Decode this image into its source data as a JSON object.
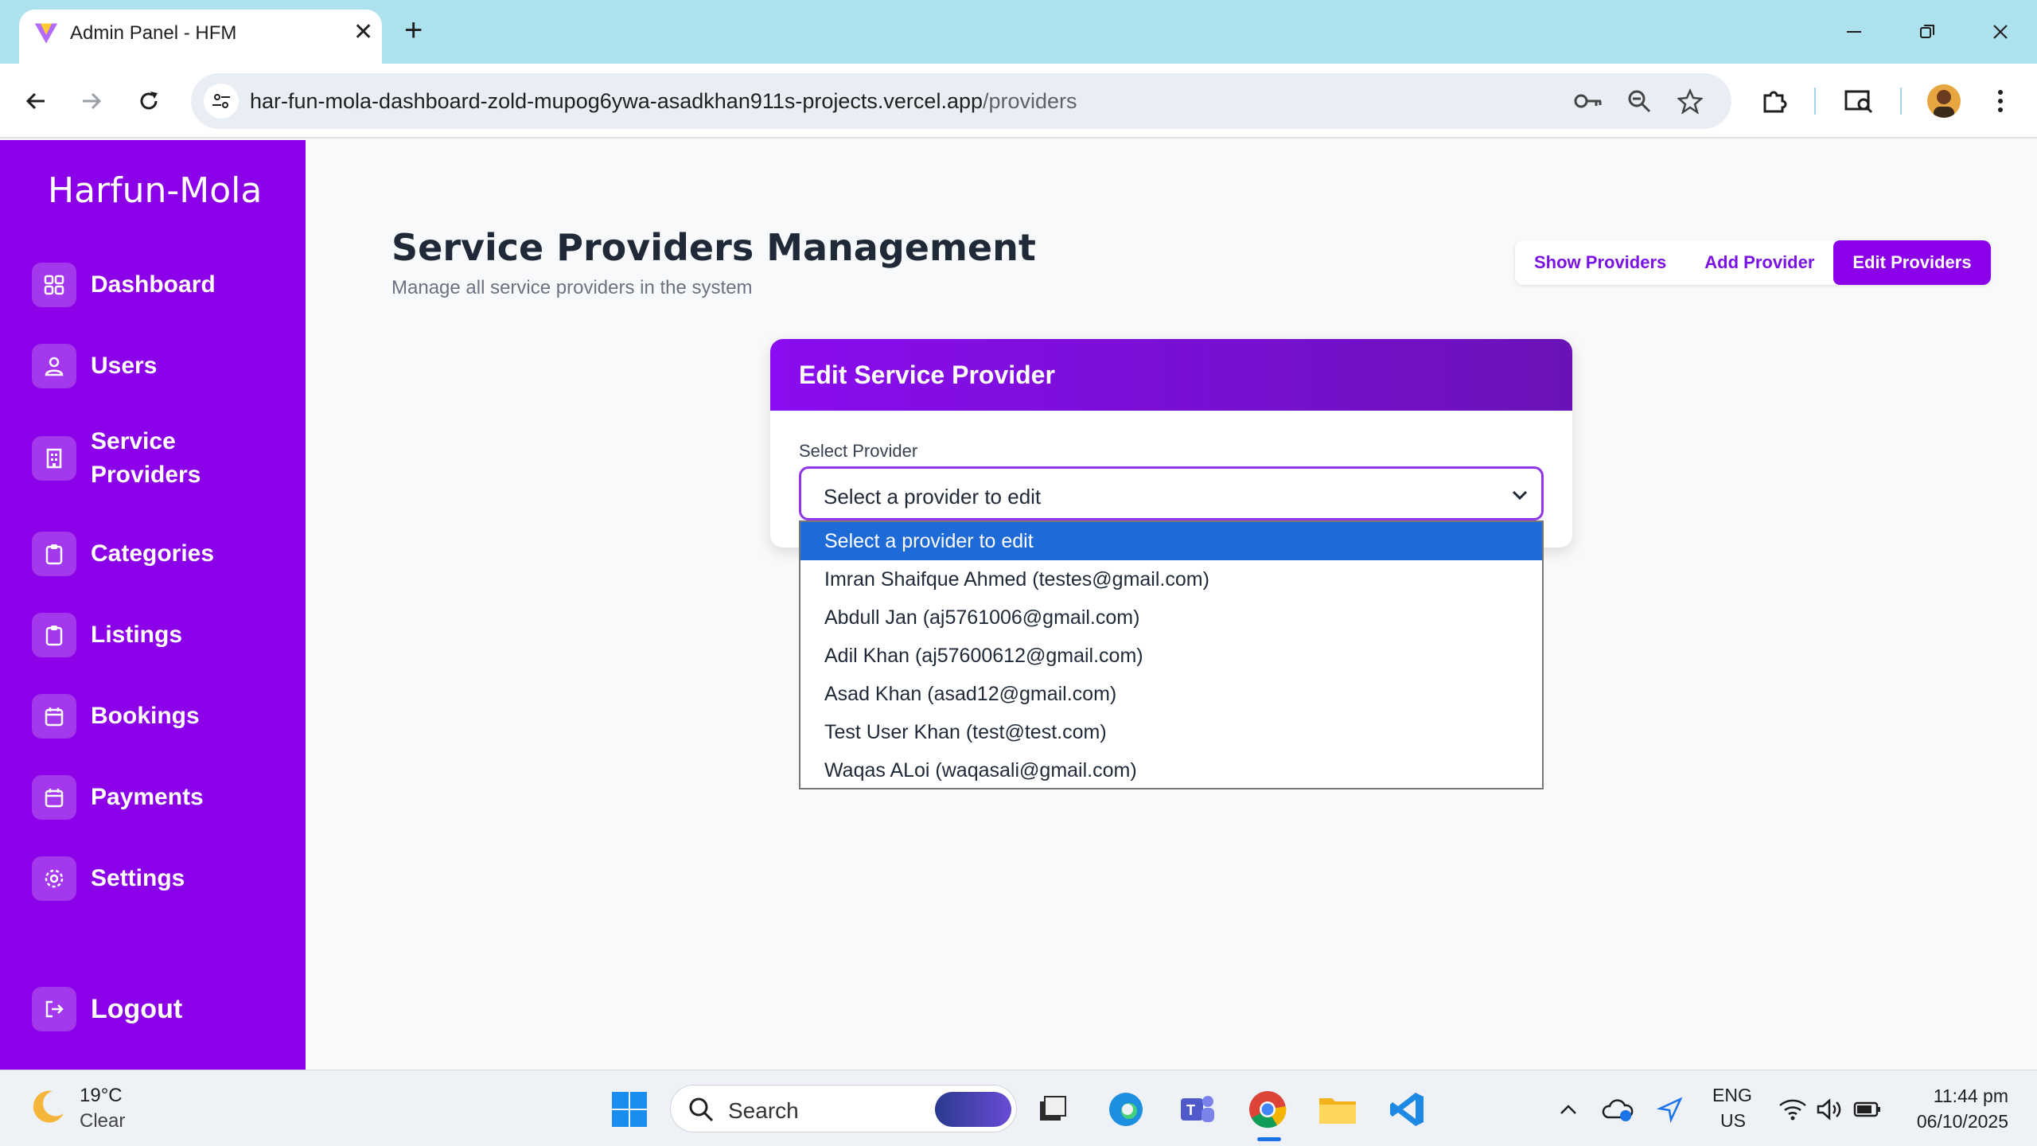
{
  "browser": {
    "tab_title": "Admin Panel - HFM",
    "url_host": "har-fun-mola-dashboard-zold-mupog6ywa-asadkhan911s-projects.vercel.app",
    "url_path": "/providers"
  },
  "sidebar": {
    "brand": "Harfun-Mola",
    "items": [
      {
        "label": "Dashboard",
        "icon": "grid-icon"
      },
      {
        "label": "Users",
        "icon": "users-icon"
      },
      {
        "label": "Service Providers",
        "icon": "building-icon"
      },
      {
        "label": "Categories",
        "icon": "clipboard-icon"
      },
      {
        "label": "Listings",
        "icon": "clipboard-icon"
      },
      {
        "label": "Bookings",
        "icon": "calendar-icon"
      },
      {
        "label": "Payments",
        "icon": "calendar-icon"
      },
      {
        "label": "Settings",
        "icon": "gear-icon"
      }
    ],
    "logout": "Logout"
  },
  "header": {
    "title": "Service Providers Management",
    "subtitle": "Manage all service providers in the system",
    "tabs": [
      "Show Providers",
      "Add Provider",
      "Edit Providers"
    ],
    "active_tab": "Edit Providers"
  },
  "card": {
    "title": "Edit Service Provider",
    "field_label": "Select Provider",
    "selected_value": "Select a provider to edit"
  },
  "dropdown": {
    "options": [
      "Select a provider to edit",
      "Imran Shaifque Ahmed (testes@gmail.com)",
      "Abdull Jan (aj5761006@gmail.com)",
      "Adil Khan (aj57600612@gmail.com)",
      "Asad Khan (asad12@gmail.com)",
      "Test User Khan (test@test.com)",
      "Waqas ALoi (waqasali@gmail.com)"
    ]
  },
  "taskbar": {
    "weather_temp": "19°C",
    "weather_cond": "Clear",
    "search_label": "Search",
    "lang_top": "ENG",
    "lang_bottom": "US",
    "time": "11:44 pm",
    "date": "06/10/2025"
  },
  "colors": {
    "accent": "#8b00e8",
    "selected_option": "#1e6ad6"
  }
}
